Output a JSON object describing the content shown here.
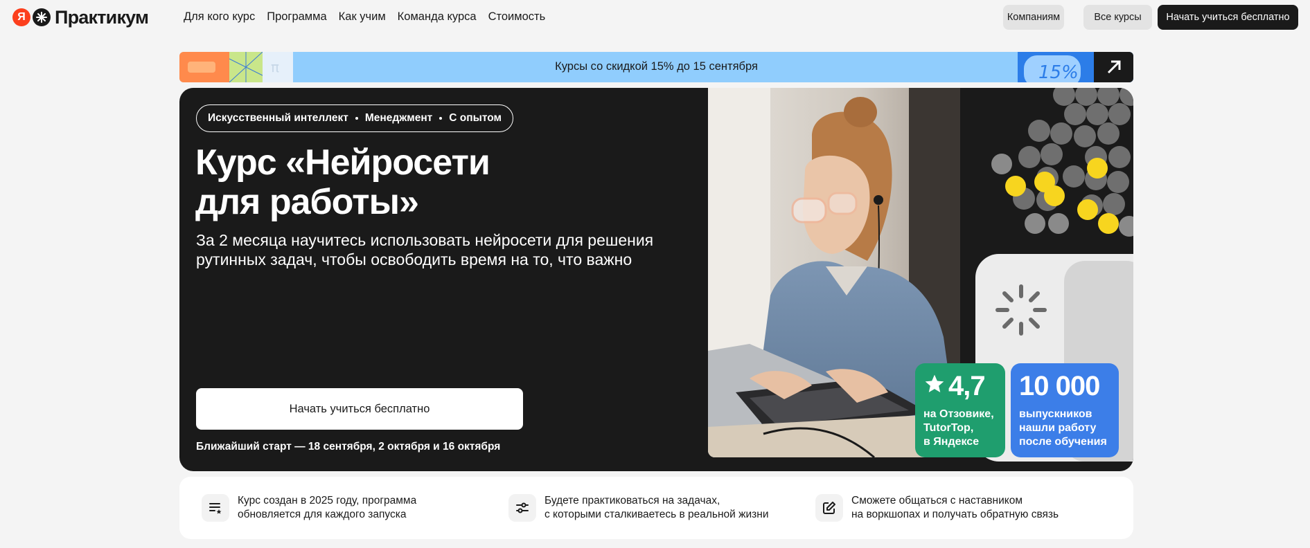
{
  "header": {
    "logo_mark": "Я",
    "logo_text": "Практикум",
    "nav": [
      "Для кого курс",
      "Программа",
      "Как учим",
      "Команда курса",
      "Стоимость"
    ],
    "buttons": {
      "companies": "Компаниям",
      "all_courses": "Все курсы",
      "start_free": "Начать учиться бесплатно"
    }
  },
  "promo": {
    "text": "Курсы со скидкой 15% до 15 сентября",
    "badge": "15%",
    "arrow_icon": "arrow-up-right-icon"
  },
  "hero": {
    "tags": [
      "Искусственный интеллект",
      "Менеджмент",
      "С опытом"
    ],
    "title_line1": "Курс «Нейросети",
    "title_line2": "для работы»",
    "subtitle": "За 2 месяца научитесь использовать нейросети для решения рутинных задач, чтобы освободить время на то, что важно",
    "cta": "Начать учиться бесплатно",
    "next_start": "Ближайший старт — 18 сентября, 2 октября и 16 октября"
  },
  "stats": [
    {
      "value": "4,7",
      "icon": "star-icon",
      "caption_lines": [
        "на Отзовике,",
        "TutorTop,",
        "в Яндексе"
      ],
      "color": "#1f9e6e"
    },
    {
      "value": "10 000",
      "caption_lines": [
        "выпускников",
        "нашли работу",
        "после обучения"
      ],
      "color": "#3c7ee8"
    }
  ],
  "features": [
    {
      "icon": "list-star-icon",
      "lines": [
        "Курс создан в 2025 году, программа",
        "обновляется для каждого запуска"
      ]
    },
    {
      "icon": "sliders-icon",
      "lines": [
        "Будете практиковаться на задачах,",
        "с которыми сталкиваетесь в реальной жизни"
      ]
    },
    {
      "icon": "edit-icon",
      "lines": [
        "Сможете общаться с наставником",
        "на воркшопах и получать обратную связь"
      ]
    }
  ],
  "colors": {
    "accent_dark": "#1a1a1a",
    "promo_bg": "#90cdfd",
    "rating_green": "#1f9e6e",
    "grads_blue": "#3c7ee8",
    "logo_red": "#fc3f1d",
    "coin_yellow": "#f7d51f"
  }
}
